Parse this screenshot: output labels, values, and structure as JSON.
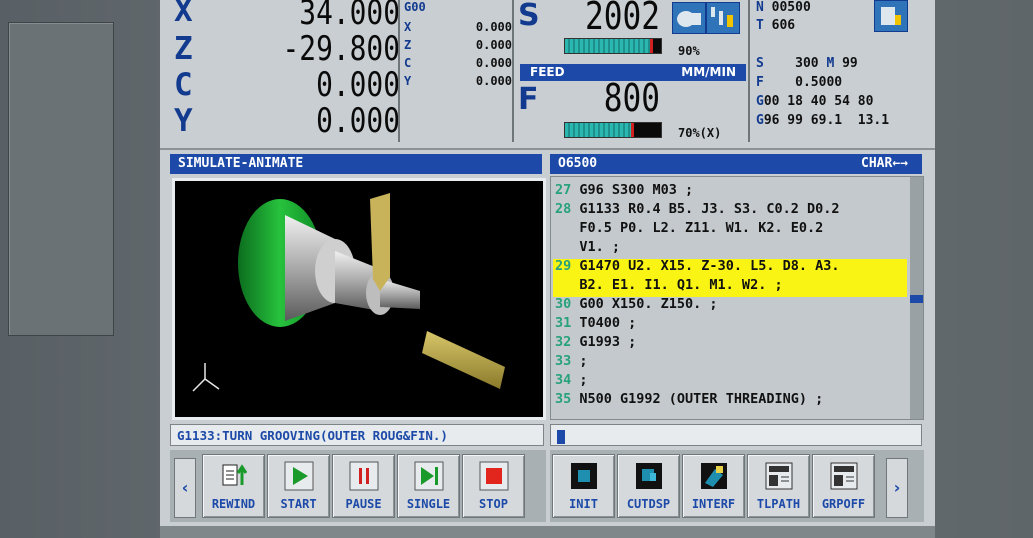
{
  "axes": [
    {
      "letter": "X",
      "value": "34.000"
    },
    {
      "letter": "Z",
      "value": "-29.800"
    },
    {
      "letter": "C",
      "value": "0.000"
    },
    {
      "letter": "Y",
      "value": "0.000"
    }
  ],
  "gcode_header": "G00",
  "small_axes": [
    {
      "letter": "X",
      "value": "0.000"
    },
    {
      "letter": "Z",
      "value": "0.000"
    },
    {
      "letter": "C",
      "value": "0.000"
    },
    {
      "letter": "Y",
      "value": "0.000"
    }
  ],
  "spindle": {
    "letter": "S",
    "value": "2002",
    "percent": "90%",
    "load_fraction": 0.9
  },
  "feed": {
    "label": "FEED",
    "unit": "MM/MIN",
    "letter": "F",
    "value": "800",
    "percent": "70%(X)",
    "load_fraction": 0.7
  },
  "info": {
    "n_label": "N",
    "n_value": "00500",
    "t_label": "T",
    "t_value": "606",
    "s_label": "S",
    "s_value": "300",
    "m_label": "M",
    "m_value": "99",
    "f_label": "F",
    "f_value": "0.5000",
    "g_line1_k": "G",
    "g_line1": "00 18 40 54 80",
    "g_line2_k": "G",
    "g_line2": "96 99 69.1  13.1"
  },
  "sim_panel": {
    "title": "SIMULATE-ANIMATE"
  },
  "program": {
    "name": "O6500",
    "mode": "CHAR←→",
    "lines": [
      {
        "num": "27",
        "text": " G96 S300 M03 ;"
      },
      {
        "num": "28",
        "text": " G1133 R0.4 B5. J3. S3. C0.2 D0.2"
      },
      {
        "num": "",
        "text": "   F0.5 P0. L2. Z11. W1. K2. E0.2"
      },
      {
        "num": "",
        "text": "   V1. ;"
      },
      {
        "num": "29",
        "text": " G1470 U2. X15. Z-30. L5. D8. A3."
      },
      {
        "num": "",
        "text": "   B2. E1. I1. Q1. M1. W2. ;"
      },
      {
        "num": "30",
        "text": " G00 X150. Z150. ;"
      },
      {
        "num": "31",
        "text": " T0400 ;"
      },
      {
        "num": "32",
        "text": " G1993 ;"
      },
      {
        "num": "33",
        "text": " ;"
      },
      {
        "num": "34",
        "text": " ;"
      },
      {
        "num": "35",
        "text": " N500 G1992 (OUTER THREADING) ;"
      }
    ]
  },
  "message": "G1133:TURN GROOVING(OUTER ROUG&FIN.)",
  "input_line": "",
  "left_keys": [
    {
      "label": "REWIND",
      "icon": "rewind-icon"
    },
    {
      "label": "START",
      "icon": "play-icon"
    },
    {
      "label": "PAUSE",
      "icon": "pause-icon"
    },
    {
      "label": "SINGLE",
      "icon": "single-step-icon"
    },
    {
      "label": "STOP",
      "icon": "stop-icon"
    }
  ],
  "right_keys": [
    {
      "label": "INIT",
      "icon": "init-icon"
    },
    {
      "label": "CUTDSP",
      "icon": "cut-display-icon"
    },
    {
      "label": "INTERF",
      "icon": "interference-icon"
    },
    {
      "label": "TLPATH",
      "icon": "tool-path-icon"
    },
    {
      "label": "GRPOFF",
      "icon": "graphics-off-icon"
    }
  ],
  "nav": {
    "prev": "‹",
    "next": "›"
  },
  "colors": {
    "accent": "#1d4aa8",
    "highlight": "#f9f414",
    "line_numbers": "#27a27a",
    "axis_letters": "#123a8f"
  }
}
